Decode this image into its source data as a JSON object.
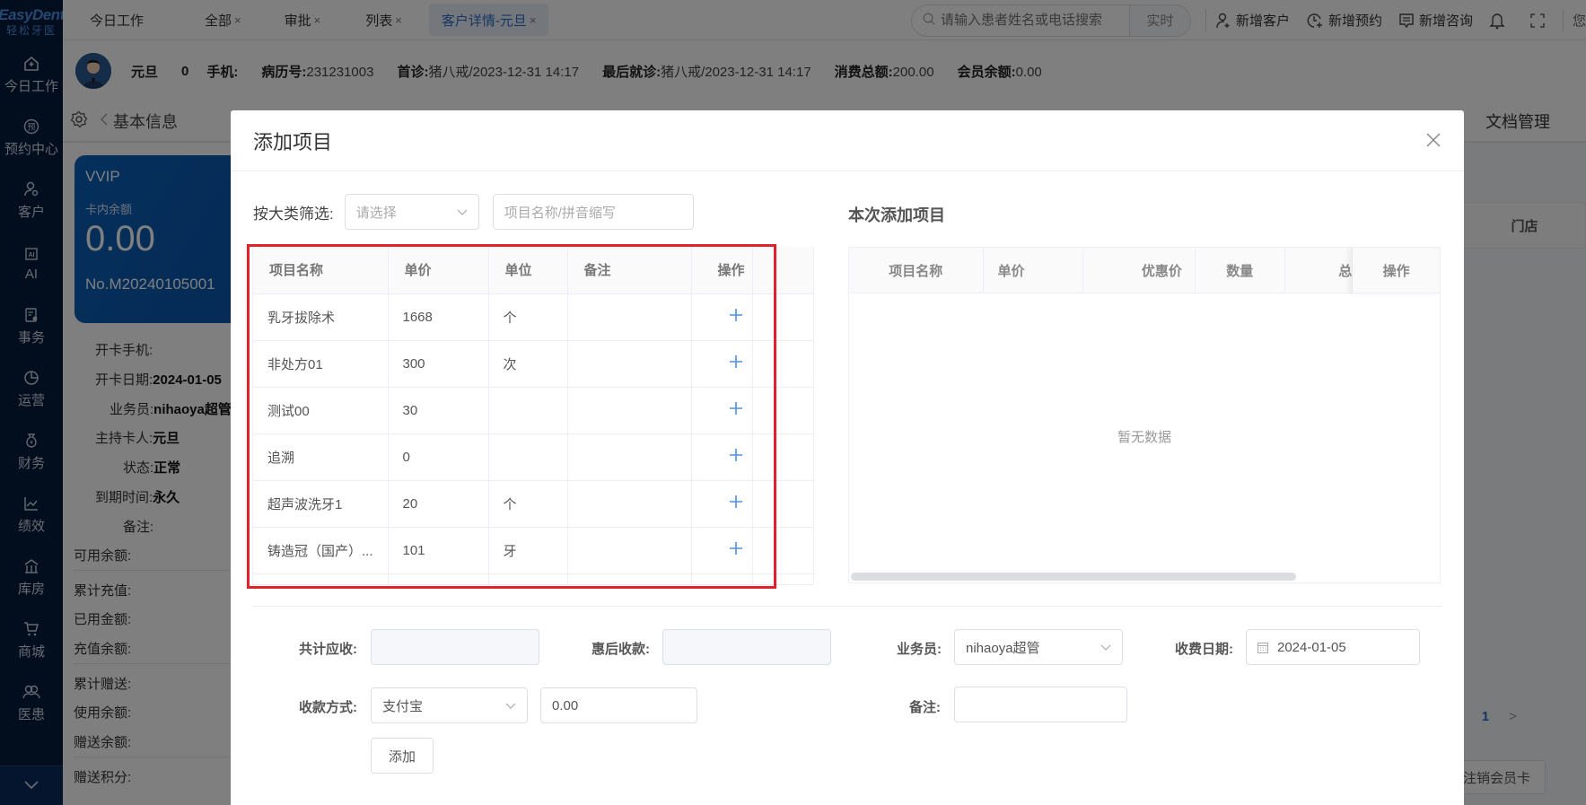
{
  "logo": {
    "en": "EasyDent",
    "cn": "轻松牙医"
  },
  "sidebar": {
    "items": [
      {
        "icon": "home-icon",
        "label": "今日工作"
      },
      {
        "icon": "appointment-icon",
        "label": "预约中心"
      },
      {
        "icon": "customer-icon",
        "label": "客户"
      },
      {
        "icon": "ai-chip-icon",
        "label": "AI"
      },
      {
        "icon": "task-icon",
        "label": "事务"
      },
      {
        "icon": "pie-chart-icon",
        "label": "运营"
      },
      {
        "icon": "finance-icon",
        "label": "财务"
      },
      {
        "icon": "line-chart-icon",
        "label": "绩效"
      },
      {
        "icon": "warehouse-icon",
        "label": "库房"
      },
      {
        "icon": "cart-icon",
        "label": "商城"
      },
      {
        "icon": "people-icon",
        "label": "医患"
      }
    ],
    "collapse_icon": "chevron-down-icon"
  },
  "topbar": {
    "tabs": [
      {
        "label": "今日工作",
        "closable": false,
        "active": false
      },
      {
        "label": "全部",
        "closable": true,
        "active": false
      },
      {
        "label": "审批",
        "closable": true,
        "active": false
      },
      {
        "label": "列表",
        "closable": true,
        "active": false
      },
      {
        "label": "客户详情-元旦",
        "closable": true,
        "active": true
      }
    ],
    "close_glyph": "×",
    "search_placeholder": "请输入患者姓名或电话搜索",
    "search_mode": "实时",
    "actions": [
      {
        "icon": "add-user-icon",
        "label": "新增客户"
      },
      {
        "icon": "add-clock-icon",
        "label": "新增预约"
      },
      {
        "icon": "message-icon",
        "label": "新增咨询"
      }
    ],
    "user_greeting_partial": "您"
  },
  "patient": {
    "name": "元旦",
    "age": "0",
    "phone_label": "手机:",
    "phone_value": "",
    "record_label": "病历号:",
    "record_value": "231231003",
    "first_visit_label": "首诊:",
    "first_visit_value": "猪八戒/2023-12-31 14:17",
    "last_visit_label": "最后就诊:",
    "last_visit_value": "猪八戒/2023-12-31 14:17",
    "total_spent_label": "消费总额:",
    "total_spent_value": "200.00",
    "member_balance_label": "会员余额:",
    "member_balance_value": "0.00"
  },
  "subtabs": {
    "back_label": "基本信息",
    "right_label": "文档管理"
  },
  "member_card": {
    "level": "VVIP",
    "balance_label": "卡内余额",
    "balance": "0.00",
    "card_no": "No.M20240105001"
  },
  "card_info": [
    {
      "label": "开卡手机:",
      "value": ""
    },
    {
      "label": "开卡日期:",
      "value": "2024-01-05"
    },
    {
      "label": "业务员:",
      "value": "nihaoya超管"
    },
    {
      "label": "主持卡人:",
      "value": "元旦"
    },
    {
      "label": "状态:",
      "value": "正常"
    },
    {
      "label": "到期时间:",
      "value": "永久"
    },
    {
      "label": "备注:",
      "value": ""
    }
  ],
  "balances": [
    {
      "label": "可用余额:"
    },
    {
      "label": "累计充值:"
    },
    {
      "label": "已用金额:"
    },
    {
      "label": "充值余额:"
    },
    {
      "label": "累计赠送:"
    },
    {
      "label": "使用余额:"
    },
    {
      "label": "赠送余额:"
    },
    {
      "label": "赠送积分:"
    }
  ],
  "background": {
    "store_col": "门店",
    "page_current": "1",
    "cancel_card": "注销会员卡"
  },
  "modal": {
    "title": "添加项目",
    "filter_label": "按大类筛选:",
    "category_placeholder": "请选择",
    "name_placeholder": "项目名称/拼音缩写",
    "items_table": {
      "columns": [
        "项目名称",
        "单价",
        "单位",
        "备注",
        "操作"
      ],
      "rows": [
        {
          "name": "乳牙拔除术",
          "price": "1668",
          "unit": "个",
          "note": ""
        },
        {
          "name": "非处方01",
          "price": "300",
          "unit": "次",
          "note": ""
        },
        {
          "name": "测试00",
          "price": "30",
          "unit": "",
          "note": ""
        },
        {
          "name": "追溯",
          "price": "0",
          "unit": "",
          "note": ""
        },
        {
          "name": "超声波洗牙1",
          "price": "20",
          "unit": "个",
          "note": ""
        },
        {
          "name": "铸造冠（国产）...",
          "price": "101",
          "unit": "牙",
          "note": ""
        }
      ]
    },
    "added_title": "本次添加项目",
    "added_table": {
      "columns": [
        "项目名称",
        "单价",
        "优惠价",
        "数量",
        "总",
        "操作"
      ],
      "empty_text": "暂无数据"
    },
    "form": {
      "total_due_label": "共计应收:",
      "total_due_value": "",
      "after_discount_label": "惠后收款:",
      "after_discount_value": "",
      "salesperson_label": "业务员:",
      "salesperson_value": "nihaoya超管",
      "charge_date_label": "收费日期:",
      "charge_date_value": "2024-01-05",
      "payment_method_label": "收款方式:",
      "payment_method_value": "支付宝",
      "payment_amount_value": "0.00",
      "remark_label": "备注:",
      "remark_value": "",
      "add_button": "添加"
    }
  },
  "colors": {
    "sidebar_bg": "#051a3c",
    "accent": "#2c6cc7",
    "highlight_border": "#e1222a",
    "card_bg": "#0b5fb8",
    "plus_icon": "#4a90e2"
  }
}
